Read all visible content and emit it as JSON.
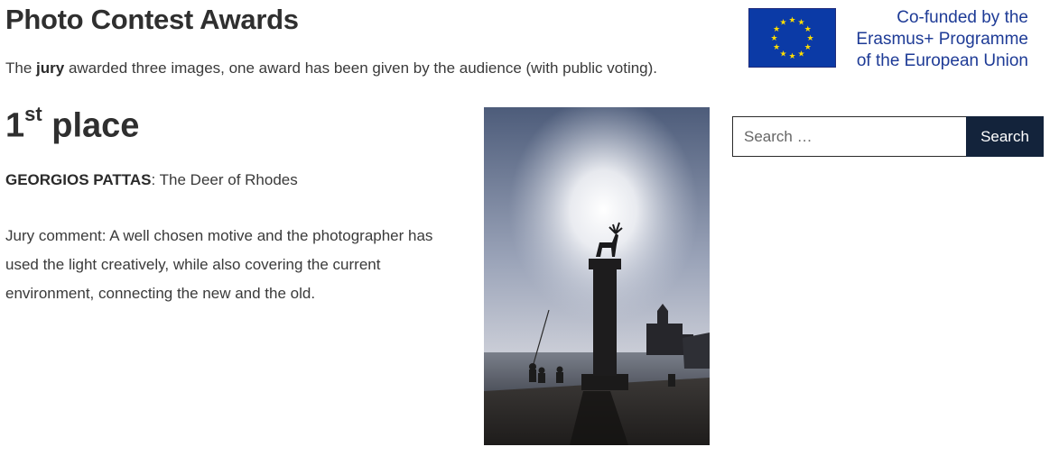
{
  "page": {
    "title": "Photo Contest Awards",
    "intro": {
      "before": "The ",
      "bold": "jury",
      "after": " awarded three images, one award has been given by the audience (with public voting)."
    }
  },
  "award": {
    "place_number": "1",
    "place_suffix": "st",
    "place_word": " place",
    "photographer": "GEORGIOS PATTAS",
    "title_separator": ": ",
    "photo_title": "The Deer of Rhodes",
    "comment": "Jury comment: A well chosen motive and the photographer has used the light creatively, while also covering the current environment, connecting the new and the old."
  },
  "logo": {
    "line1": "Co-funded by the",
    "line2": "Erasmus+ Programme",
    "line3": "of the European Union",
    "flag_blue": "#0b3aa6",
    "star_yellow": "#ffdd00",
    "text_color": "#1e3b96"
  },
  "search": {
    "placeholder": "Search …",
    "button_label": "Search",
    "button_color": "#13233b"
  }
}
